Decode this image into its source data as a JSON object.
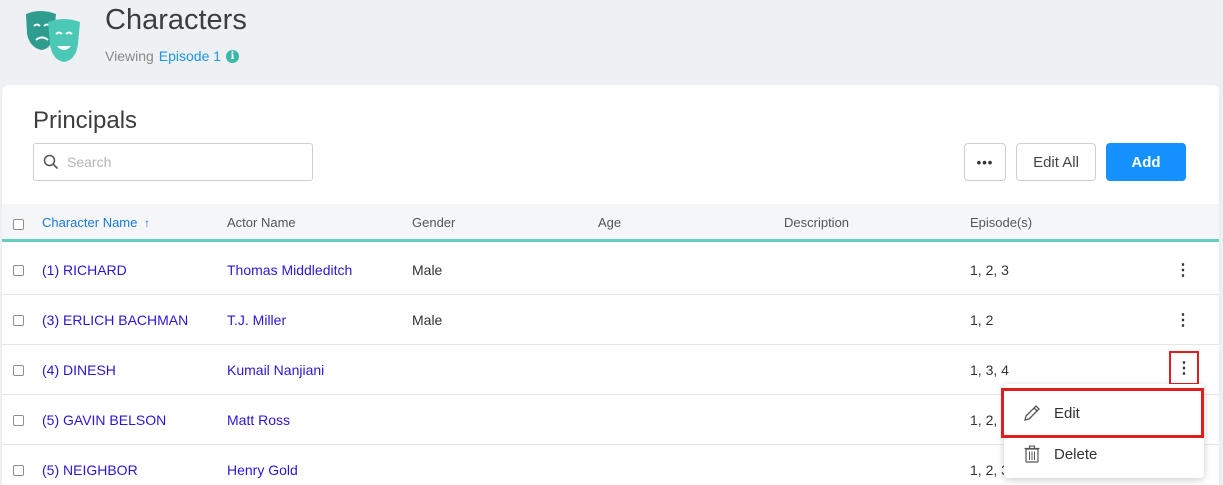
{
  "header": {
    "title": "Characters",
    "viewing_prefix": "Viewing",
    "episode_link": "Episode 1",
    "info_icon": "i"
  },
  "section": {
    "title": "Principals",
    "search_placeholder": "Search",
    "more_label": "•••",
    "edit_all_label": "Edit All",
    "add_label": "Add"
  },
  "table": {
    "columns": {
      "character": "Character Name",
      "sort_indicator": "↑",
      "actor": "Actor Name",
      "gender": "Gender",
      "age": "Age",
      "description": "Description",
      "episodes": "Episode(s)"
    },
    "rows": [
      {
        "character": "(1) RICHARD",
        "actor": "Thomas Middleditch",
        "gender": "Male",
        "age": "",
        "description": "",
        "episodes": "1, 2, 3"
      },
      {
        "character": "(3) ERLICH BACHMAN",
        "actor": "T.J. Miller",
        "gender": "Male",
        "age": "",
        "description": "",
        "episodes": "1, 2"
      },
      {
        "character": "(4) DINESH",
        "actor": "Kumail Nanjiani",
        "gender": "",
        "age": "",
        "description": "",
        "episodes": "1, 3, 4"
      },
      {
        "character": "(5) GAVIN BELSON",
        "actor": "Matt Ross",
        "gender": "",
        "age": "",
        "description": "",
        "episodes": "1, 2, 3"
      },
      {
        "character": "(5) NEIGHBOR",
        "actor": "Henry Gold",
        "gender": "",
        "age": "",
        "description": "",
        "episodes": "1, 2, 3"
      }
    ],
    "kebab_label": "⋮"
  },
  "menu": {
    "edit_label": "Edit",
    "delete_label": "Delete"
  },
  "colors": {
    "accent": "#1592ff",
    "teal": "#66cdbd",
    "link": "#2a16d6",
    "highlight": "#e01e1e"
  }
}
